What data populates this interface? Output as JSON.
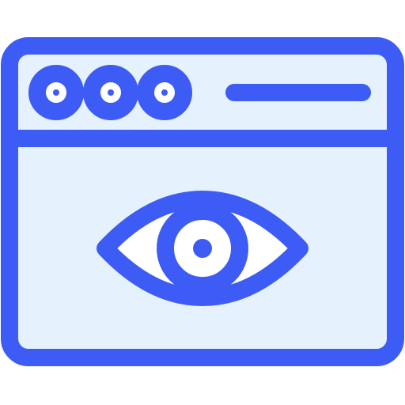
{
  "icon": {
    "name": "browser-window-eye-icon",
    "colors": {
      "stroke": "#3D5CF5",
      "fill": "#E5F1FC",
      "background": "#FFFFFF"
    },
    "parts": {
      "window": "browser-window",
      "controls": [
        "window-dot-1",
        "window-dot-2",
        "window-dot-3"
      ],
      "address_bar": "address-bar-line",
      "visual": "eye-icon"
    }
  }
}
